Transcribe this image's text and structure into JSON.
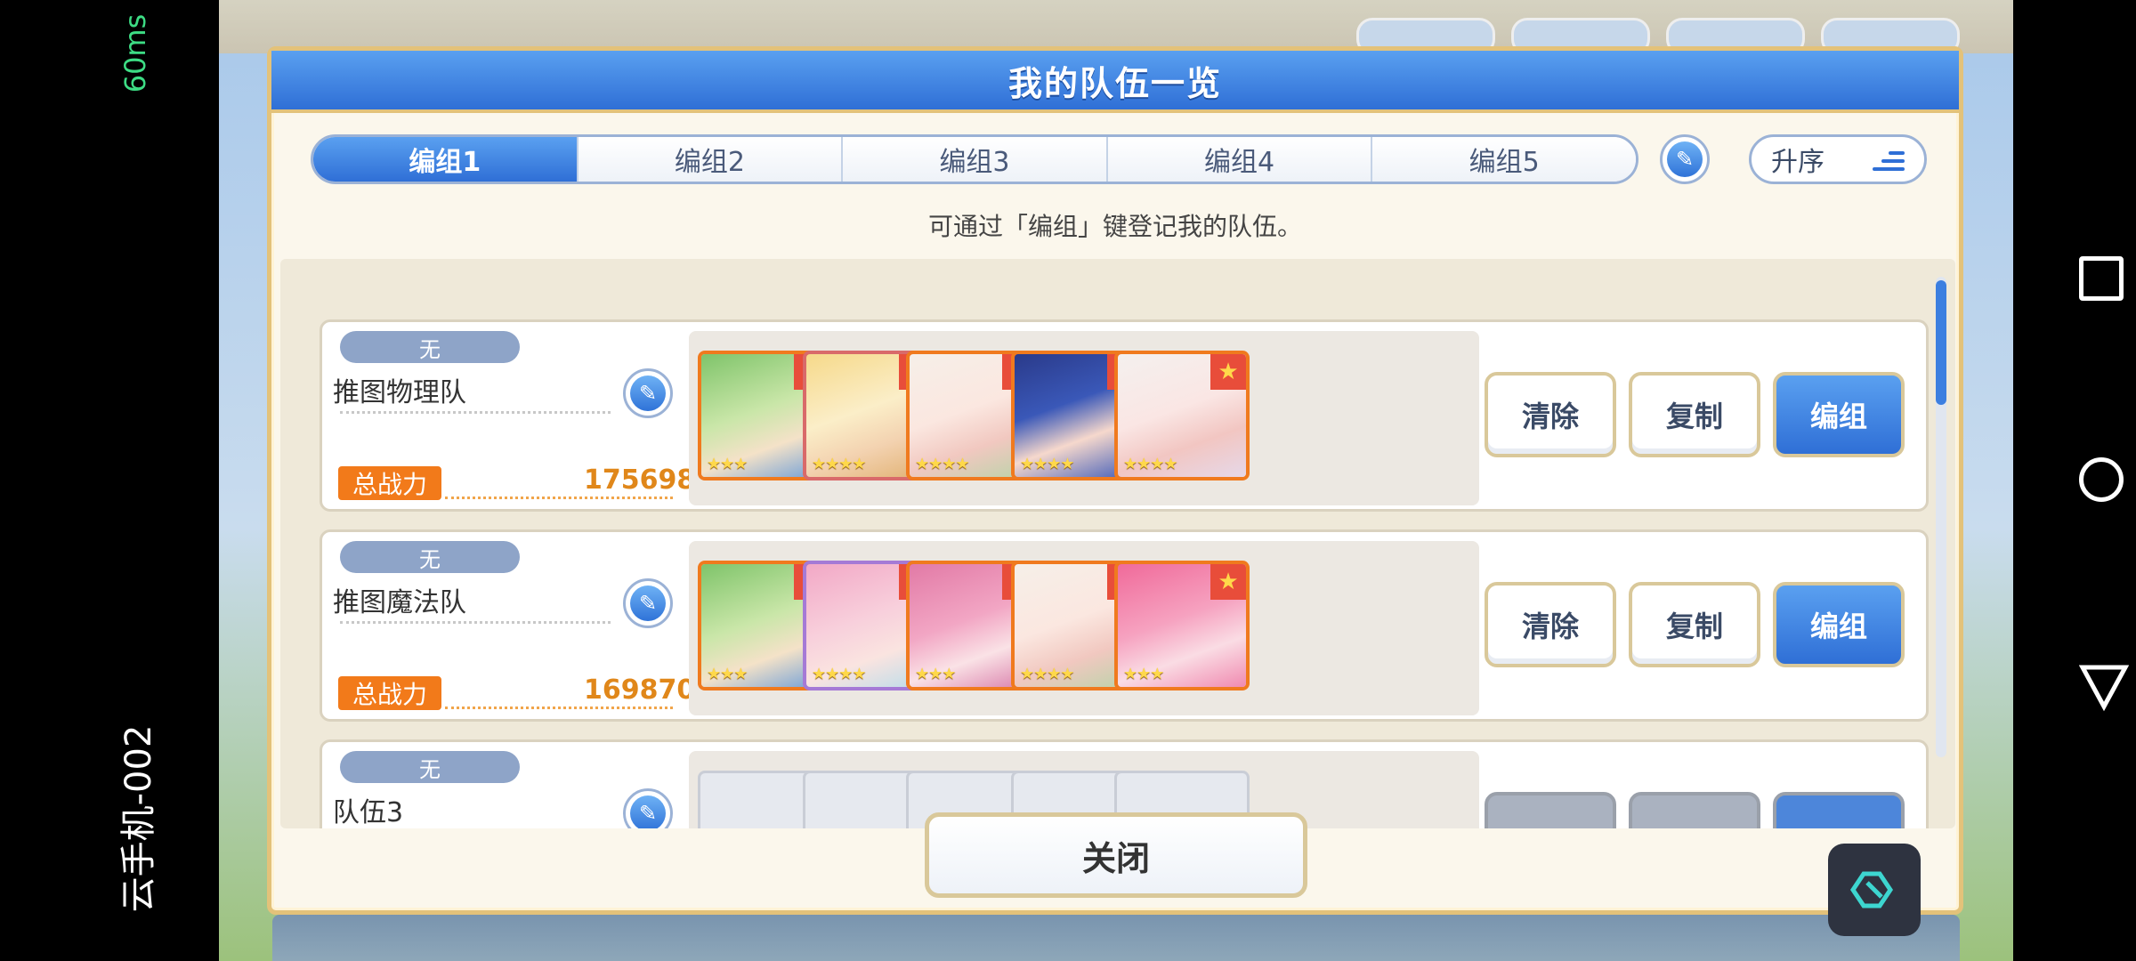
{
  "overlay": {
    "ping": "60ms",
    "device_name": "云手机-002"
  },
  "dialog": {
    "title": "我的队伍一览",
    "tabs": [
      "编组1",
      "编组2",
      "编组3",
      "编组4",
      "编组5"
    ],
    "active_tab": "编组1",
    "sort_label": "升序",
    "hint": "可通过「编组」键登记我的队伍。",
    "teams": [
      {
        "badge": "无",
        "name": "推图物理队",
        "power_label": "总战力",
        "power_value": "175698",
        "buttons": {
          "clear": "清除",
          "copy": "复制",
          "edit": "编组"
        }
      },
      {
        "badge": "无",
        "name": "推图魔法队",
        "power_label": "总战力",
        "power_value": "169870",
        "buttons": {
          "clear": "清除",
          "copy": "复制",
          "edit": "编组"
        }
      },
      {
        "badge": "无",
        "name": "队伍3"
      }
    ],
    "close_label": "关闭"
  },
  "colors": {
    "accent_blue": "#2f6fd6",
    "power_orange": "#f27a1a",
    "gold_border": "#e3c27a"
  },
  "icons": [
    "pencil-icon",
    "sort-ascending-icon",
    "favorite-star-icon",
    "square-nav-icon",
    "circle-nav-icon",
    "triangle-back-icon",
    "floating-tool-icon"
  ]
}
